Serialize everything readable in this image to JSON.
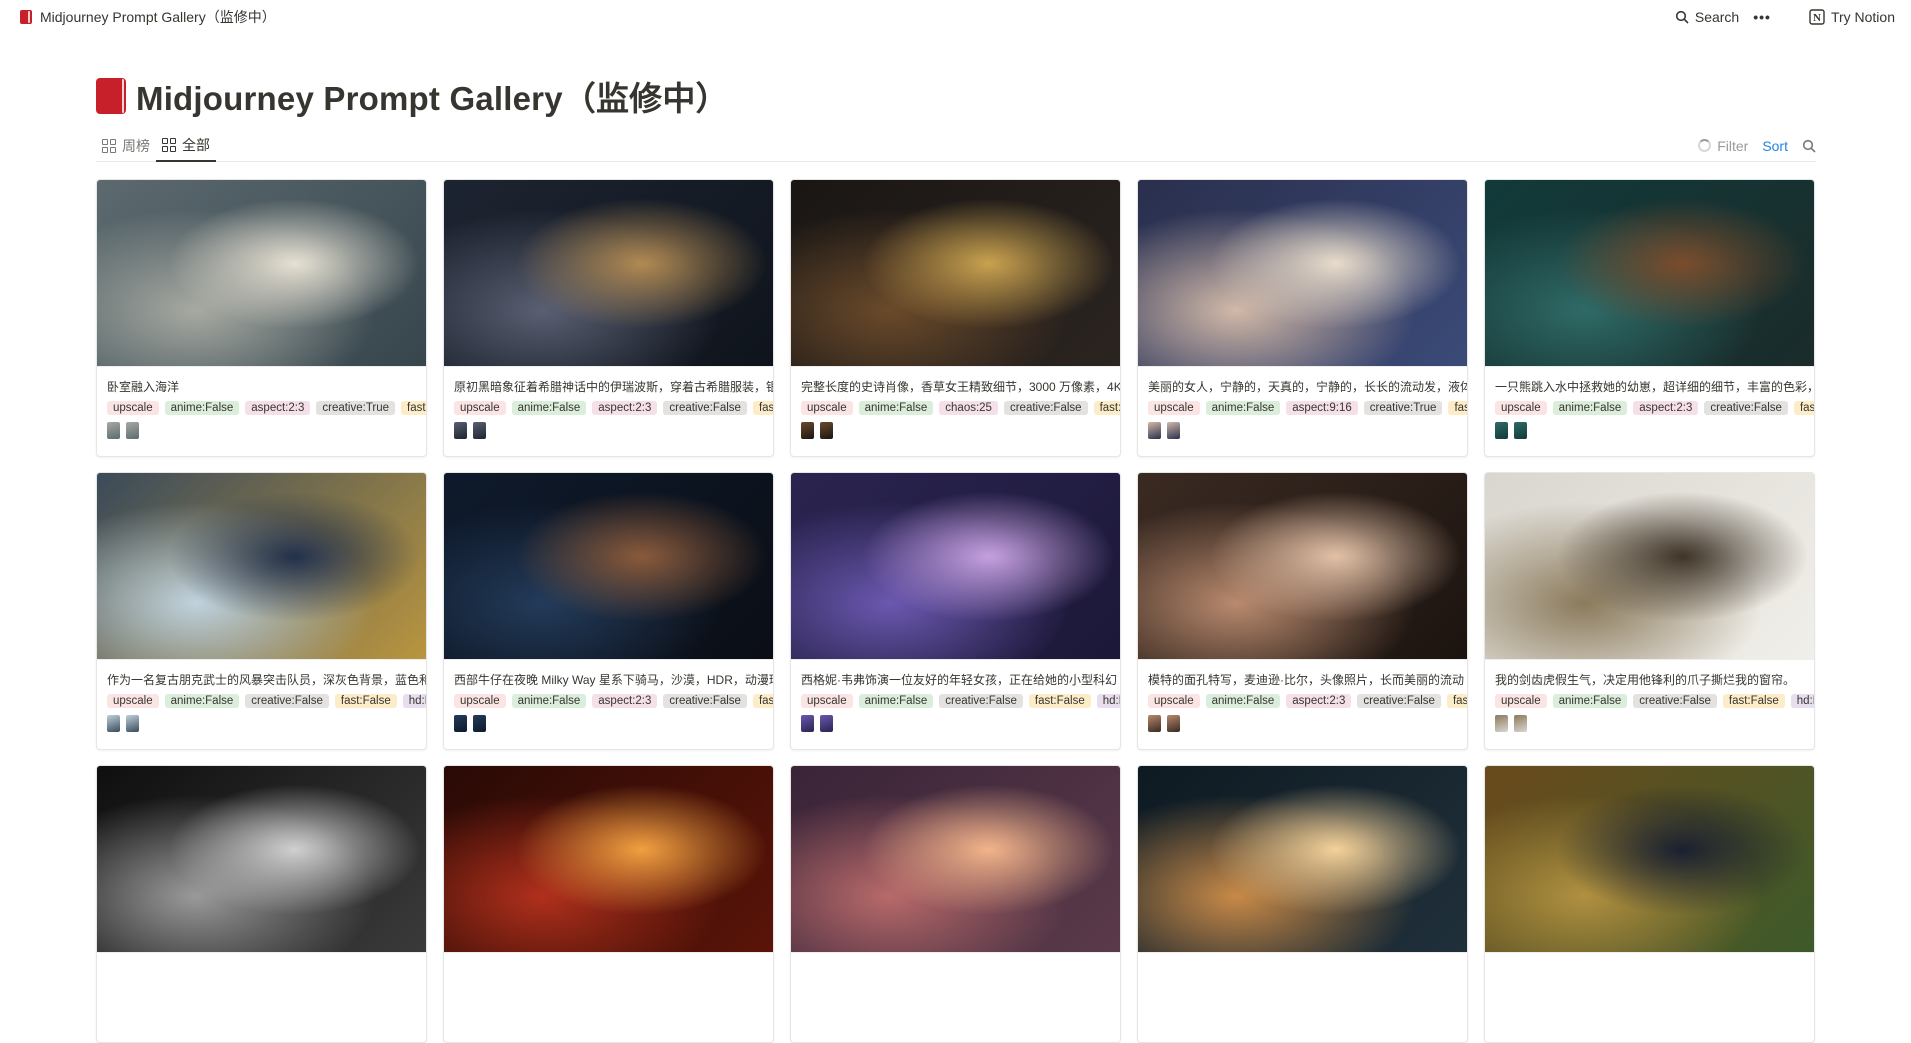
{
  "topbar": {
    "page_title": "Midjourney Prompt Gallery（监修中）",
    "search_label": "Search",
    "more_label": "•••",
    "try_notion_label": "Try Notion"
  },
  "page": {
    "title": "Midjourney Prompt Gallery（监修中）"
  },
  "views": {
    "tabs": [
      {
        "label": "周榜"
      },
      {
        "label": "全部"
      }
    ],
    "filter_label": "Filter",
    "sort_label": "Sort"
  },
  "tag_colors": {
    "upscale": "#fbe4e4",
    "anime": "#dbeddb",
    "aspect": "#f5e0e9",
    "chaos": "#f5e0e9",
    "creative": "#e3e2e0",
    "fast": "#fdecc8",
    "hd": "#e8deee"
  },
  "cards": [
    {
      "caption": "卧室融入海洋",
      "tags": [
        "upscale",
        "anime:False",
        "aspect:2:3",
        "creative:True",
        "fast:False"
      ],
      "img": "bedroom-ocean",
      "colors": [
        "#5c6a70",
        "#a7aaa2",
        "#e7e1d3",
        "#37464d"
      ]
    },
    {
      "caption": "原初黑暗象征着希腊神话中的伊瑞波斯，穿着古希腊服装，银",
      "tags": [
        "upscale",
        "anime:False",
        "aspect:2:3",
        "creative:False",
        "fast:False"
      ],
      "img": "erebus",
      "colors": [
        "#1d2431",
        "#5a5f72",
        "#b18a52",
        "#0f141c"
      ]
    },
    {
      "caption": "完整长度的史诗肖像，香草女王精致细节，3000 万像素，4K",
      "tags": [
        "upscale",
        "anime:False",
        "chaos:25",
        "creative:False",
        "fast:False"
      ],
      "img": "queen",
      "colors": [
        "#1a1614",
        "#6b4a2a",
        "#c9a24f",
        "#2b2420"
      ]
    },
    {
      "caption": "美丽的女人，宁静的，天真的，宁静的，长长的流动发，液体",
      "tags": [
        "upscale",
        "anime:False",
        "aspect:9:16",
        "creative:True",
        "fast:False"
      ],
      "img": "woman-hair",
      "colors": [
        "#2a2f4d",
        "#d2b9a8",
        "#e8dccb",
        "#3b4a78"
      ]
    },
    {
      "caption": "一只熊跳入水中拯救她的幼崽，超详细的细节，丰富的色彩，",
      "tags": [
        "upscale",
        "anime:False",
        "aspect:2:3",
        "creative:False",
        "fast:False"
      ],
      "img": "bear",
      "colors": [
        "#123a3a",
        "#2f6a66",
        "#7a4c2c",
        "#1a2b2a"
      ]
    },
    {
      "caption": "作为一名复古朋克武士的风暴突击队员，深灰色背景，蓝色和",
      "tags": [
        "upscale",
        "anime:False",
        "creative:False",
        "fast:False",
        "hd:False"
      ],
      "img": "samurai",
      "colors": [
        "#3a4a5a",
        "#bfd2dd",
        "#22304a",
        "#b9953f"
      ]
    },
    {
      "caption": "西部牛仔在夜晚 Milky Way 星系下骑马，沙漠，HDR，动漫环",
      "tags": [
        "upscale",
        "anime:False",
        "aspect:2:3",
        "creative:False",
        "fast:False"
      ],
      "img": "cowboy",
      "colors": [
        "#0e1a2c",
        "#233b5a",
        "#8a5a3a",
        "#0b0e15"
      ]
    },
    {
      "caption": "西格妮·韦弗饰演一位友好的年轻女孩，正在给她的小型科幻",
      "tags": [
        "upscale",
        "anime:False",
        "creative:False",
        "fast:False",
        "hd:False"
      ],
      "img": "girl-alien",
      "colors": [
        "#2a2450",
        "#6b58b0",
        "#c6a0e0",
        "#1c1838"
      ]
    },
    {
      "caption": "模特的面孔特写，麦迪逊·比尔，头像照片，长而美丽的流动",
      "tags": [
        "upscale",
        "anime:False",
        "aspect:2:3",
        "creative:False",
        "fast:False"
      ],
      "img": "face",
      "colors": [
        "#3a2a22",
        "#b98a6e",
        "#e3c1a7",
        "#1c1410"
      ]
    },
    {
      "caption": "我的剑齿虎假生气，决定用他锋利的爪子撕烂我的窗帘。",
      "tags": [
        "upscale",
        "anime:False",
        "creative:False",
        "fast:False",
        "hd:False"
      ],
      "img": "tiger",
      "colors": [
        "#d9d6cf",
        "#8b7a5c",
        "#3e3428",
        "#f1efe9"
      ]
    },
    {
      "caption": "",
      "tags": [],
      "img": "skull",
      "colors": [
        "#0f0f0f",
        "#9a9a9a",
        "#d0d0d0",
        "#3a3a3a"
      ]
    },
    {
      "caption": "",
      "tags": [],
      "img": "snake",
      "colors": [
        "#2a0a06",
        "#b0301c",
        "#f0a040",
        "#5a1408"
      ]
    },
    {
      "caption": "",
      "tags": [],
      "img": "tower",
      "colors": [
        "#3a2438",
        "#b86a6a",
        "#f2b48a",
        "#5a3a4a"
      ]
    },
    {
      "caption": "",
      "tags": [],
      "img": "bottle-ship",
      "colors": [
        "#0e1a22",
        "#c88a48",
        "#f4d29a",
        "#20303a"
      ]
    },
    {
      "caption": "",
      "tags": [],
      "img": "raven",
      "colors": [
        "#6a4a1c",
        "#b09040",
        "#1a2030",
        "#3e5a2a"
      ]
    }
  ]
}
